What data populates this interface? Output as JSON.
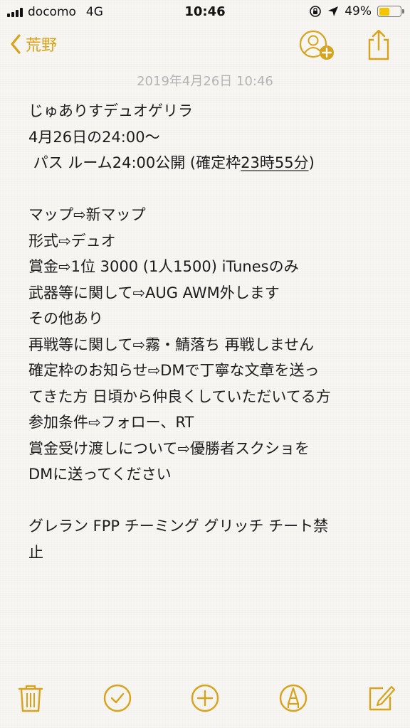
{
  "status_bar": {
    "carrier": "docomo",
    "network": "4G",
    "time": "10:46",
    "battery_text": "49%",
    "battery_level": 0.49,
    "battery_color": "#f5c400"
  },
  "nav": {
    "back_label": "荒野",
    "accent_color": "#d9a21b",
    "icons": {
      "back": "chevron-left-icon",
      "add_person": "add-person-icon",
      "share": "share-icon"
    }
  },
  "note": {
    "date": "2019年4月26日 10:46",
    "lines": [
      "じゅありすデュオゲリラ",
      "4月26日の24:00〜",
      " パス ルーム24:00公開 (確定枠23時55分)",
      "",
      "マップ⇨新マップ",
      "形式⇨デュオ",
      "賞金⇨1位 3000 (1人1500) iTunesのみ",
      "武器等に関して⇨AUG AWM外します",
      "その他あり",
      "再戦等に関して⇨霧・鯖落ち 再戦しません",
      "確定枠のお知らせ⇨DMで丁寧な文章を送っ",
      "てきた方 日頃から仲良くしていただいてる方",
      "参加条件⇨フォロー、RT",
      "賞金受け渡しについて⇨優勝者スクショを",
      "DMに送ってください",
      "",
      "グレラン FPP チーミング グリッチ チート禁",
      "止"
    ]
  },
  "toolbar": {
    "icons": [
      "trash-icon",
      "checklist-icon",
      "add-icon",
      "sketch-icon",
      "compose-icon"
    ]
  }
}
